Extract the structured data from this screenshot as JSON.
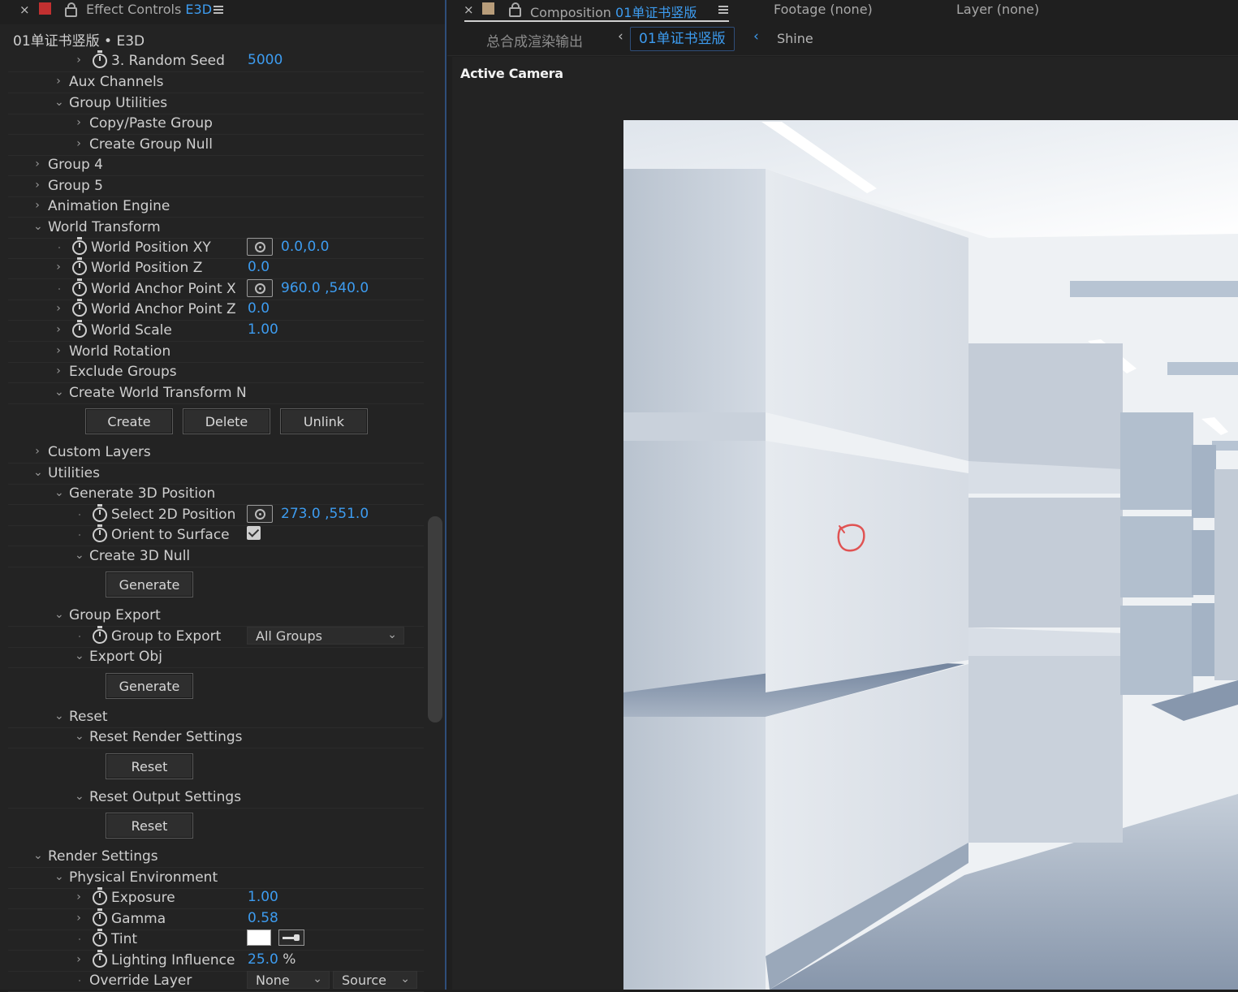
{
  "left_panel": {
    "tab": {
      "close": "×",
      "title_prefix": "Effect Controls",
      "title_layer": "E3D",
      "swatch_color": "#c23030"
    },
    "layer_header": "01单证书竖版 • E3D",
    "rows": [
      {
        "label": "3. Random Seed",
        "value": "5000"
      },
      {
        "label": "Aux Channels"
      },
      {
        "label": "Group Utilities"
      },
      {
        "label": "Copy/Paste Group"
      },
      {
        "label": "Create Group Null"
      },
      {
        "label": "Group 4"
      },
      {
        "label": "Group 5"
      },
      {
        "label": "Animation Engine"
      },
      {
        "label": "World Transform"
      },
      {
        "label": "World Position XY",
        "value": "0.0,0.0"
      },
      {
        "label": "World Position Z",
        "value": "0.0"
      },
      {
        "label": "World Anchor Point X",
        "value": "960.0 ,540.0"
      },
      {
        "label": "World Anchor Point Z",
        "value": "0.0"
      },
      {
        "label": "World Scale",
        "value": "1.00"
      },
      {
        "label": "World Rotation"
      },
      {
        "label": "Exclude Groups"
      },
      {
        "label": "Create World Transform N"
      },
      {
        "label": "Custom Layers"
      },
      {
        "label": "Utilities"
      },
      {
        "label": "Generate 3D Position"
      },
      {
        "label": "Select 2D Position",
        "value": "273.0 ,551.0"
      },
      {
        "label": "Orient to Surface",
        "checked": true
      },
      {
        "label": "Create 3D Null"
      },
      {
        "label": "Group Export"
      },
      {
        "label": "Group to Export",
        "value": "All Groups"
      },
      {
        "label": "Export Obj"
      },
      {
        "label": "Reset"
      },
      {
        "label": "Reset Render Settings"
      },
      {
        "label": "Reset Output Settings"
      },
      {
        "label": "Render Settings"
      },
      {
        "label": "Physical Environment"
      },
      {
        "label": "Exposure",
        "value": "1.00"
      },
      {
        "label": "Gamma",
        "value": "0.58"
      },
      {
        "label": "Tint"
      },
      {
        "label": "Lighting Influence",
        "value": "25.0",
        "unit": "%"
      },
      {
        "label": "Override Layer",
        "value": "None",
        "value2": "Source"
      }
    ],
    "buttons": {
      "create": "Create",
      "delete": "Delete",
      "unlink": "Unlink",
      "generate_null": "Generate",
      "generate_obj": "Generate",
      "reset_render": "Reset",
      "reset_output": "Reset"
    }
  },
  "right_panel": {
    "tabs": {
      "close": "×",
      "comp_prefix": "Composition",
      "comp_name": "01单证书竖版",
      "comp_swatch_color": "#b89d7a",
      "footage": "Footage  (none)",
      "layer": "Layer  (none)"
    },
    "breadcrumbs": {
      "parent": "总合成渲染输出",
      "active": "01单证书竖版",
      "child": "Shine",
      "left_arrow": "‹",
      "right_arrow": "‹"
    },
    "viewer": {
      "camera_label": "Active Camera"
    },
    "colors": {
      "accent_blue": "#3d9cf0",
      "panel_border": "#2f4e7a"
    }
  }
}
